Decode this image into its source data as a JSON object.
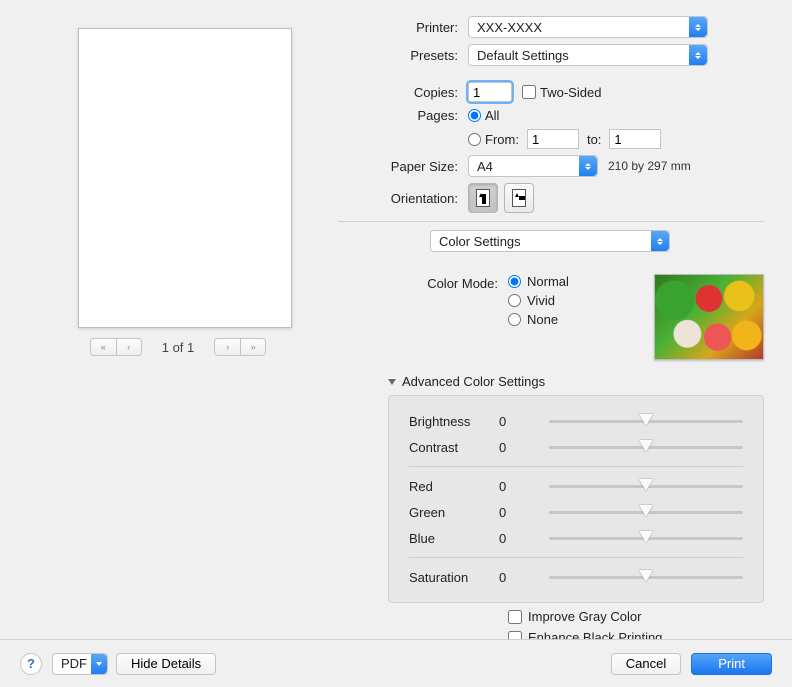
{
  "labels": {
    "printer": "Printer:",
    "presets": "Presets:",
    "copies": "Copies:",
    "two_sided": "Two-Sided",
    "pages": "Pages:",
    "all": "All",
    "from": "From:",
    "to": "to:",
    "paper_size": "Paper Size:",
    "orientation": "Orientation:",
    "color_mode": "Color Mode:",
    "advanced": "Advanced Color Settings",
    "improve_gray": "Improve Gray Color",
    "enhance_black": "Enhance Black Printing"
  },
  "printer": {
    "value": "XXX-XXXX"
  },
  "presets": {
    "value": "Default Settings"
  },
  "copies": {
    "value": "1",
    "two_sided": false
  },
  "pages": {
    "mode": "all",
    "from": "1",
    "to": "1"
  },
  "paper_size": {
    "value": "A4",
    "note": "210 by 297 mm"
  },
  "orientation": {
    "value": "portrait"
  },
  "section_dropdown": {
    "value": "Color Settings"
  },
  "color_mode": {
    "options": {
      "normal": "Normal",
      "vivid": "Vivid",
      "none": "None"
    },
    "value": "normal"
  },
  "advanced": {
    "brightness": {
      "label": "Brightness",
      "value": "0"
    },
    "contrast": {
      "label": "Contrast",
      "value": "0"
    },
    "red": {
      "label": "Red",
      "value": "0"
    },
    "green": {
      "label": "Green",
      "value": "0"
    },
    "blue": {
      "label": "Blue",
      "value": "0"
    },
    "saturation": {
      "label": "Saturation",
      "value": "0"
    }
  },
  "options": {
    "improve_gray": false,
    "enhance_black": false
  },
  "preview": {
    "page_text": "1 of 1"
  },
  "footer": {
    "pdf": "PDF",
    "hide_details": "Hide Details",
    "cancel": "Cancel",
    "print": "Print"
  }
}
